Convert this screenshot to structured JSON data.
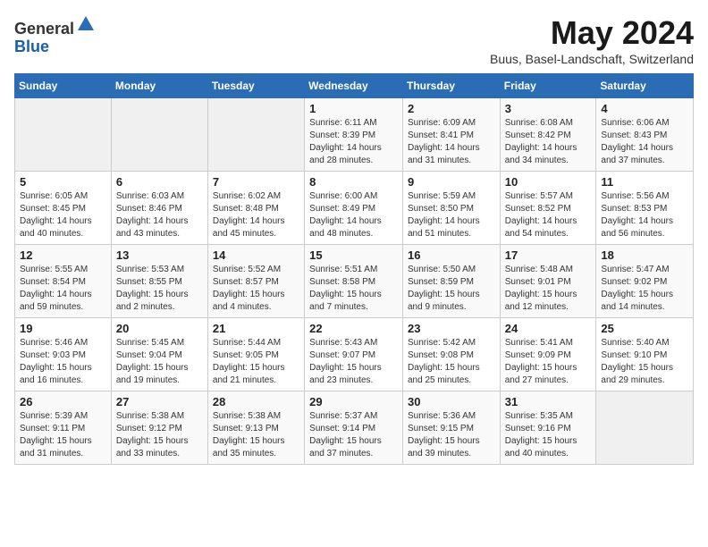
{
  "header": {
    "logo_general": "General",
    "logo_blue": "Blue",
    "month": "May 2024",
    "location": "Buus, Basel-Landschaft, Switzerland"
  },
  "weekdays": [
    "Sunday",
    "Monday",
    "Tuesday",
    "Wednesday",
    "Thursday",
    "Friday",
    "Saturday"
  ],
  "weeks": [
    [
      {
        "day": "",
        "info": ""
      },
      {
        "day": "",
        "info": ""
      },
      {
        "day": "",
        "info": ""
      },
      {
        "day": "1",
        "info": "Sunrise: 6:11 AM\nSunset: 8:39 PM\nDaylight: 14 hours\nand 28 minutes."
      },
      {
        "day": "2",
        "info": "Sunrise: 6:09 AM\nSunset: 8:41 PM\nDaylight: 14 hours\nand 31 minutes."
      },
      {
        "day": "3",
        "info": "Sunrise: 6:08 AM\nSunset: 8:42 PM\nDaylight: 14 hours\nand 34 minutes."
      },
      {
        "day": "4",
        "info": "Sunrise: 6:06 AM\nSunset: 8:43 PM\nDaylight: 14 hours\nand 37 minutes."
      }
    ],
    [
      {
        "day": "5",
        "info": "Sunrise: 6:05 AM\nSunset: 8:45 PM\nDaylight: 14 hours\nand 40 minutes."
      },
      {
        "day": "6",
        "info": "Sunrise: 6:03 AM\nSunset: 8:46 PM\nDaylight: 14 hours\nand 43 minutes."
      },
      {
        "day": "7",
        "info": "Sunrise: 6:02 AM\nSunset: 8:48 PM\nDaylight: 14 hours\nand 45 minutes."
      },
      {
        "day": "8",
        "info": "Sunrise: 6:00 AM\nSunset: 8:49 PM\nDaylight: 14 hours\nand 48 minutes."
      },
      {
        "day": "9",
        "info": "Sunrise: 5:59 AM\nSunset: 8:50 PM\nDaylight: 14 hours\nand 51 minutes."
      },
      {
        "day": "10",
        "info": "Sunrise: 5:57 AM\nSunset: 8:52 PM\nDaylight: 14 hours\nand 54 minutes."
      },
      {
        "day": "11",
        "info": "Sunrise: 5:56 AM\nSunset: 8:53 PM\nDaylight: 14 hours\nand 56 minutes."
      }
    ],
    [
      {
        "day": "12",
        "info": "Sunrise: 5:55 AM\nSunset: 8:54 PM\nDaylight: 14 hours\nand 59 minutes."
      },
      {
        "day": "13",
        "info": "Sunrise: 5:53 AM\nSunset: 8:55 PM\nDaylight: 15 hours\nand 2 minutes."
      },
      {
        "day": "14",
        "info": "Sunrise: 5:52 AM\nSunset: 8:57 PM\nDaylight: 15 hours\nand 4 minutes."
      },
      {
        "day": "15",
        "info": "Sunrise: 5:51 AM\nSunset: 8:58 PM\nDaylight: 15 hours\nand 7 minutes."
      },
      {
        "day": "16",
        "info": "Sunrise: 5:50 AM\nSunset: 8:59 PM\nDaylight: 15 hours\nand 9 minutes."
      },
      {
        "day": "17",
        "info": "Sunrise: 5:48 AM\nSunset: 9:01 PM\nDaylight: 15 hours\nand 12 minutes."
      },
      {
        "day": "18",
        "info": "Sunrise: 5:47 AM\nSunset: 9:02 PM\nDaylight: 15 hours\nand 14 minutes."
      }
    ],
    [
      {
        "day": "19",
        "info": "Sunrise: 5:46 AM\nSunset: 9:03 PM\nDaylight: 15 hours\nand 16 minutes."
      },
      {
        "day": "20",
        "info": "Sunrise: 5:45 AM\nSunset: 9:04 PM\nDaylight: 15 hours\nand 19 minutes."
      },
      {
        "day": "21",
        "info": "Sunrise: 5:44 AM\nSunset: 9:05 PM\nDaylight: 15 hours\nand 21 minutes."
      },
      {
        "day": "22",
        "info": "Sunrise: 5:43 AM\nSunset: 9:07 PM\nDaylight: 15 hours\nand 23 minutes."
      },
      {
        "day": "23",
        "info": "Sunrise: 5:42 AM\nSunset: 9:08 PM\nDaylight: 15 hours\nand 25 minutes."
      },
      {
        "day": "24",
        "info": "Sunrise: 5:41 AM\nSunset: 9:09 PM\nDaylight: 15 hours\nand 27 minutes."
      },
      {
        "day": "25",
        "info": "Sunrise: 5:40 AM\nSunset: 9:10 PM\nDaylight: 15 hours\nand 29 minutes."
      }
    ],
    [
      {
        "day": "26",
        "info": "Sunrise: 5:39 AM\nSunset: 9:11 PM\nDaylight: 15 hours\nand 31 minutes."
      },
      {
        "day": "27",
        "info": "Sunrise: 5:38 AM\nSunset: 9:12 PM\nDaylight: 15 hours\nand 33 minutes."
      },
      {
        "day": "28",
        "info": "Sunrise: 5:38 AM\nSunset: 9:13 PM\nDaylight: 15 hours\nand 35 minutes."
      },
      {
        "day": "29",
        "info": "Sunrise: 5:37 AM\nSunset: 9:14 PM\nDaylight: 15 hours\nand 37 minutes."
      },
      {
        "day": "30",
        "info": "Sunrise: 5:36 AM\nSunset: 9:15 PM\nDaylight: 15 hours\nand 39 minutes."
      },
      {
        "day": "31",
        "info": "Sunrise: 5:35 AM\nSunset: 9:16 PM\nDaylight: 15 hours\nand 40 minutes."
      },
      {
        "day": "",
        "info": ""
      }
    ]
  ]
}
